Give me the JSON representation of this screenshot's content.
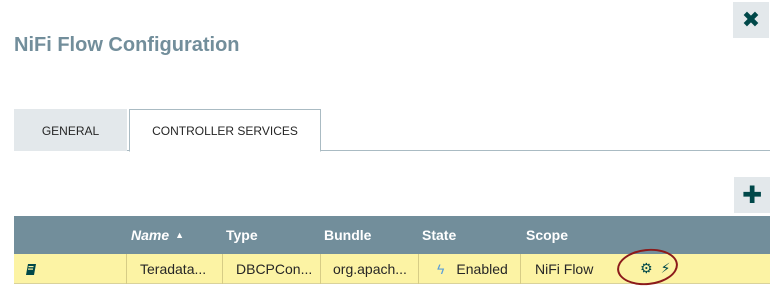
{
  "dialog": {
    "title": "NiFi Flow Configuration",
    "close_icon": "close-icon",
    "close_glyph": "✖"
  },
  "tabs": [
    {
      "label": "GENERAL",
      "selected": false
    },
    {
      "label": "CONTROLLER SERVICES",
      "selected": true
    }
  ],
  "toolbar": {
    "add_icon": "add-icon",
    "add_glyph": "✚"
  },
  "table": {
    "columns": {
      "name": "Name",
      "type": "Type",
      "bundle": "Bundle",
      "state": "State",
      "scope": "Scope"
    },
    "sort_glyph": "▲",
    "rows": [
      {
        "icon": "usage-book-icon",
        "name": "Teradata...",
        "type": "DBCPCon...",
        "bundle": "org.apach...",
        "state_icon": "enabled-bolt-icon",
        "state_glyph": "ϟ",
        "state": "Enabled",
        "scope": "NiFi Flow",
        "actions": {
          "configure_glyph": "⚙",
          "disable_glyph": "⚡︎"
        }
      }
    ]
  },
  "colors": {
    "title": "#728e9b",
    "header_bg": "#728e9b",
    "row_highlight": "#fcf3a4",
    "button_bg": "#e3e8eb",
    "button_fg": "#004849",
    "annotation": "#8b1a1a"
  }
}
